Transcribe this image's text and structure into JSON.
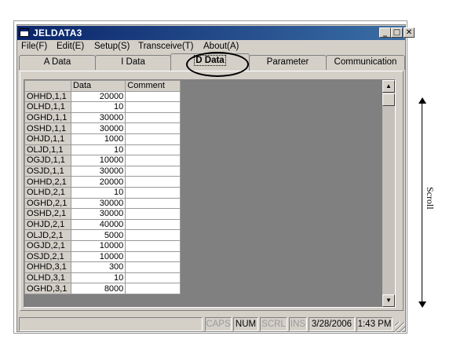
{
  "window": {
    "title": "JELDATA3",
    "controls": [
      "_",
      "□",
      "✕"
    ]
  },
  "menu": [
    "File(F)",
    "Edit(E)",
    "Setup(S)",
    "Transceive(T)",
    "About(A)"
  ],
  "tabs": [
    "A Data",
    "I Data",
    "D Data",
    "Parameter",
    "Communication"
  ],
  "active_tab": "D Data",
  "grid": {
    "headers": [
      "",
      "Data",
      "Comment"
    ],
    "rows": [
      {
        "name": "OHHD,1,1",
        "data": "20000",
        "comment": ""
      },
      {
        "name": "OLHD,1,1",
        "data": "10",
        "comment": ""
      },
      {
        "name": "OGHD,1,1",
        "data": "30000",
        "comment": ""
      },
      {
        "name": "OSHD,1,1",
        "data": "30000",
        "comment": ""
      },
      {
        "name": "OHJD,1,1",
        "data": "1000",
        "comment": ""
      },
      {
        "name": "OLJD,1,1",
        "data": "10",
        "comment": ""
      },
      {
        "name": "OGJD,1,1",
        "data": "10000",
        "comment": ""
      },
      {
        "name": "OSJD,1,1",
        "data": "30000",
        "comment": ""
      },
      {
        "name": "OHHD,2,1",
        "data": "20000",
        "comment": ""
      },
      {
        "name": "OLHD,2,1",
        "data": "10",
        "comment": ""
      },
      {
        "name": "OGHD,2,1",
        "data": "30000",
        "comment": ""
      },
      {
        "name": "OSHD,2,1",
        "data": "30000",
        "comment": ""
      },
      {
        "name": "OHJD,2,1",
        "data": "40000",
        "comment": ""
      },
      {
        "name": "OLJD,2,1",
        "data": "5000",
        "comment": ""
      },
      {
        "name": "OGJD,2,1",
        "data": "10000",
        "comment": ""
      },
      {
        "name": "OSJD,2,1",
        "data": "10000",
        "comment": ""
      },
      {
        "name": "OHHD,3,1",
        "data": "300",
        "comment": ""
      },
      {
        "name": "OLHD,3,1",
        "data": "10",
        "comment": ""
      },
      {
        "name": "OGHD,3,1",
        "data": "8000",
        "comment": ""
      }
    ]
  },
  "scrollbar": {
    "up_arrow": "▲",
    "down_arrow": "▼"
  },
  "status": {
    "caps": "CAPS",
    "num": "NUM",
    "scrl": "SCRL",
    "ins": "INS",
    "date": "3/28/2006",
    "time": "1:43 PM"
  },
  "annotation": {
    "scroll_label": "Scroll"
  }
}
